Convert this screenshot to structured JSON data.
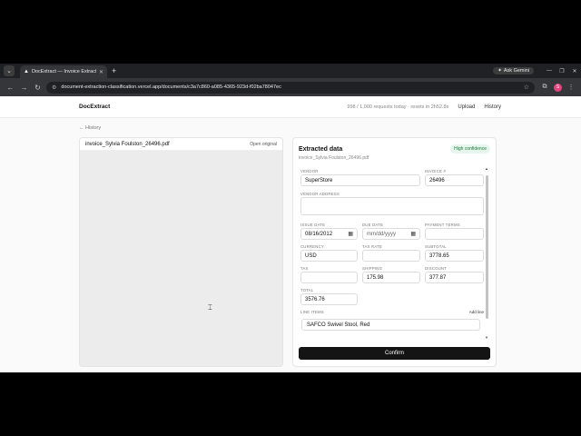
{
  "browser": {
    "tab_title": "DocExtract — Invoice Extraction",
    "new_tab_icon": "plus-icon",
    "gemini_label": "Ask Gemini",
    "url": "document-extraction-classification.vercel.app/documents/c3a7c860-a085-4365-923d-f02ba78047ec",
    "profile_initial": "S"
  },
  "app": {
    "brand": "DocExtract",
    "quota": "998 / 1,000 requests today · resets in 2h52.8s",
    "nav": {
      "upload": "Upload",
      "history": "History"
    },
    "back_label": "← History"
  },
  "preview": {
    "filename": "invoice_Sylvia Foulston_26496.pdf",
    "open_original": "Open original"
  },
  "panel": {
    "title": "Extracted data",
    "subtitle": "invoice_Sylvia Foulston_26496.pdf",
    "confidence": "High confidence",
    "fields": {
      "vendor": {
        "label": "VENDOR",
        "value": "SuperStore"
      },
      "invoice_no": {
        "label": "INVOICE #",
        "value": "26496"
      },
      "vendor_address": {
        "label": "VENDOR ADDRESS",
        "value": ""
      },
      "issue_date": {
        "label": "ISSUE DATE",
        "value": "08/16/2012"
      },
      "due_date": {
        "label": "DUE DATE",
        "placeholder": "mm/dd/yyyy"
      },
      "payment_terms": {
        "label": "PAYMENT TERMS",
        "value": ""
      },
      "currency": {
        "label": "CURRENCY",
        "value": "USD"
      },
      "tax_rate": {
        "label": "TAX RATE",
        "value": ""
      },
      "subtotal": {
        "label": "SUBTOTAL",
        "value": "3778.65"
      },
      "tax": {
        "label": "TAX",
        "value": ""
      },
      "shipping": {
        "label": "SHIPPING",
        "value": "175.98"
      },
      "discount": {
        "label": "DISCOUNT",
        "value": "377.87"
      },
      "total": {
        "label": "TOTAL",
        "value": "3576.76"
      }
    },
    "line_items": {
      "label": "LINE ITEMS",
      "add_label": "Add line",
      "items": [
        "SAFCO Swivel Stool, Red"
      ]
    },
    "confirm_label": "Confirm"
  }
}
